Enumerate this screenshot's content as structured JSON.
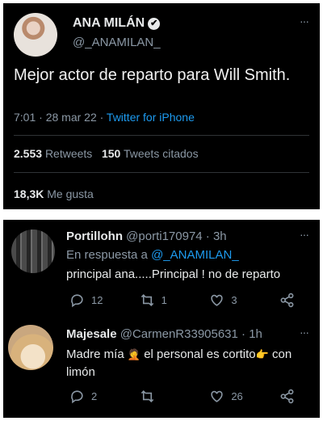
{
  "tweet": {
    "name": "ANA MILÁN",
    "handle": "@_ANAMILAN_",
    "text": "Mejor actor de reparto para Will Smith.",
    "time": "7:01 · 28 mar 22 · ",
    "source": "Twitter for iPhone",
    "retweets": "2.553",
    "retweets_label": "Retweets",
    "quotes": "150",
    "quotes_label": "Tweets citados",
    "likes": "18,3K",
    "likes_label": "Me gusta",
    "more": "···"
  },
  "replies": [
    {
      "name": "Portillohn",
      "handle": "@porti170974 · 3h",
      "reply_prefix": "En respuesta a ",
      "reply_to": "@_ANAMILAN_",
      "text": "principal ana.....Principal ! no de reparto",
      "comments": "12",
      "retweets": "1",
      "likes": "3",
      "more": "···"
    },
    {
      "name": "Majesale",
      "handle": "@CarmenR33905631 · 1h",
      "text_a": "Madre mía ",
      "emoji_a": "🤦",
      "text_b": " el personal es cortito",
      "emoji_b": "👉",
      "text_c": " con limón",
      "comments": "2",
      "retweets": "",
      "likes": "26",
      "more": "···"
    }
  ],
  "icons": [
    "verified-icon",
    "more-icon",
    "reply-icon",
    "retweet-icon",
    "like-icon",
    "share-icon"
  ],
  "colors": {
    "background": "#000000",
    "text": "#e7e9ea",
    "muted": "#8b98a5",
    "accent": "#1d9bf0"
  }
}
